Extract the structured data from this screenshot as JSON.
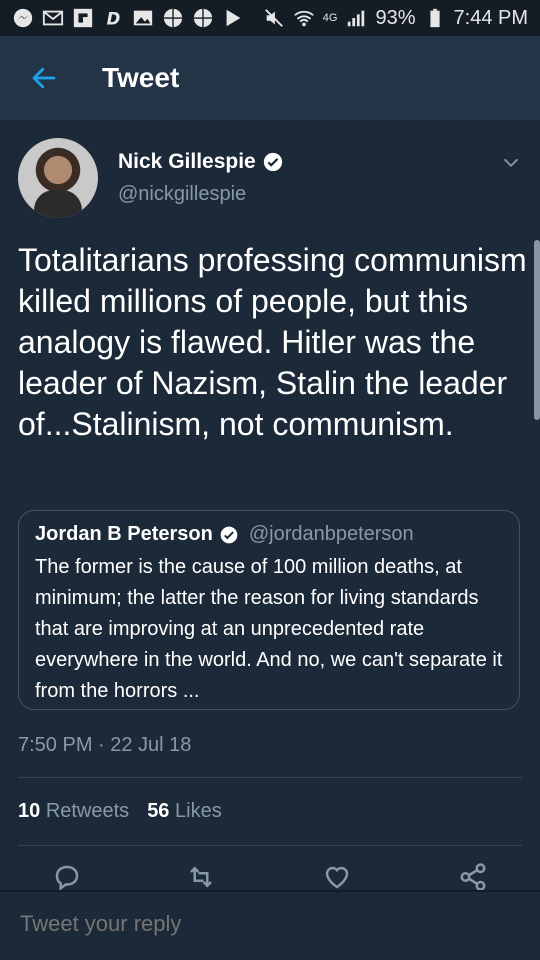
{
  "status_bar": {
    "battery_percent": "93%",
    "time": "7:44 PM",
    "network": "4G"
  },
  "header": {
    "title": "Tweet"
  },
  "tweet": {
    "display_name": "Nick Gillespie",
    "handle": "@nickgillespie",
    "text": "Totalitarians professing communism killed millions of people, but this analogy is flawed. Hitler was the leader of Nazism, Stalin the leader of...Stalinism, not communism.",
    "quoted": {
      "display_name": "Jordan B Peterson",
      "handle": "@jordanbpeterson",
      "text": "The former is the cause of 100 million deaths, at minimum; the latter the reason for living standards that are improving at an unprecedented rate everywhere in the world. And no, we can't separate it from the horrors ..."
    },
    "timestamp": "7:50 PM · 22 Jul 18",
    "retweets_count": "10",
    "retweets_label": "Retweets",
    "likes_count": "56",
    "likes_label": "Likes"
  },
  "reply": {
    "placeholder": "Tweet your reply"
  },
  "colors": {
    "background": "#1c2938",
    "header": "#243447",
    "accent": "#1da1f2",
    "muted": "#8899a6"
  }
}
